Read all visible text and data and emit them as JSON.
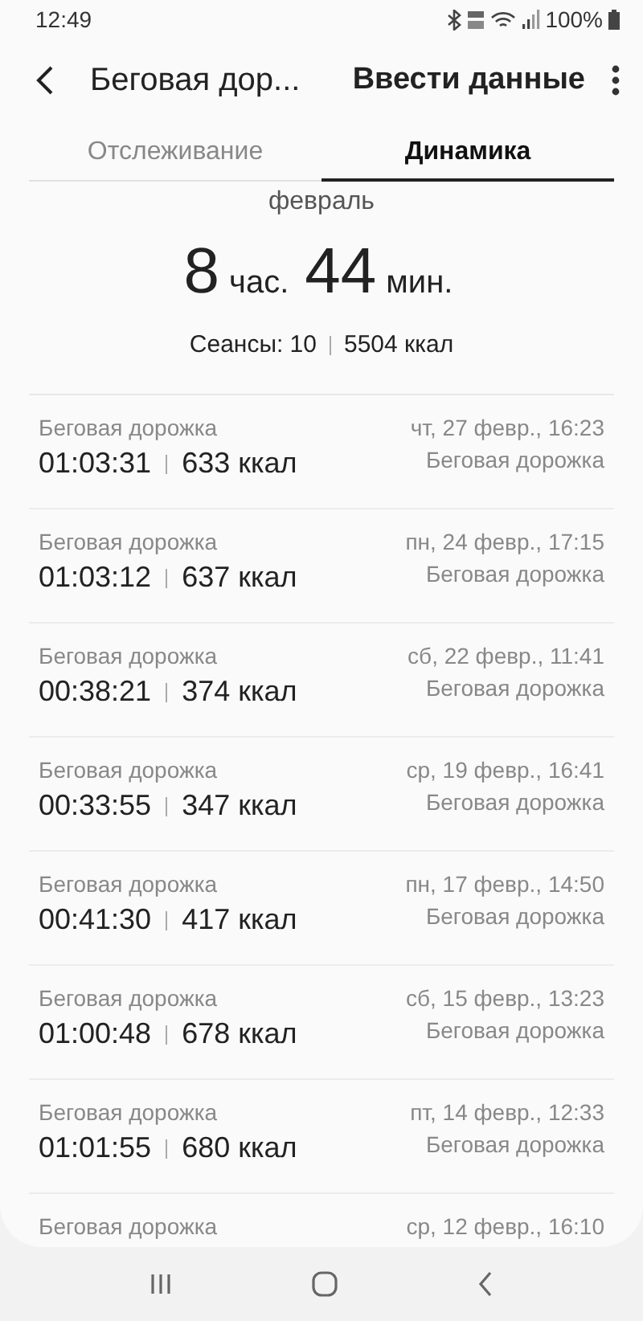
{
  "status_bar": {
    "time": "12:49",
    "battery_text": "100%"
  },
  "header": {
    "title": "Беговая дор...",
    "action": "Ввести данные"
  },
  "tabs": [
    {
      "label": "Отслеживание",
      "selected": false
    },
    {
      "label": "Динамика",
      "selected": true
    }
  ],
  "summary": {
    "month": "февраль",
    "hours": "8",
    "hours_unit": "час.",
    "minutes": "44",
    "minutes_unit": "мин.",
    "sessions": "Сеансы: 10",
    "calories": "5504 ккал"
  },
  "sessions": [
    {
      "title": "Беговая дорожка",
      "duration": "01:03:31",
      "calories": "633 ккал",
      "date": "чт, 27 февр., 16:23",
      "type": "Беговая дорожка"
    },
    {
      "title": "Беговая дорожка",
      "duration": "01:03:12",
      "calories": "637 ккал",
      "date": "пн, 24 февр., 17:15",
      "type": "Беговая дорожка"
    },
    {
      "title": "Беговая дорожка",
      "duration": "00:38:21",
      "calories": "374 ккал",
      "date": "сб, 22 февр., 11:41",
      "type": "Беговая дорожка"
    },
    {
      "title": "Беговая дорожка",
      "duration": "00:33:55",
      "calories": "347 ккал",
      "date": "ср, 19 февр., 16:41",
      "type": "Беговая дорожка"
    },
    {
      "title": "Беговая дорожка",
      "duration": "00:41:30",
      "calories": "417 ккал",
      "date": "пн, 17 февр., 14:50",
      "type": "Беговая дорожка"
    },
    {
      "title": "Беговая дорожка",
      "duration": "01:00:48",
      "calories": "678 ккал",
      "date": "сб, 15 февр., 13:23",
      "type": "Беговая дорожка"
    },
    {
      "title": "Беговая дорожка",
      "duration": "01:01:55",
      "calories": "680 ккал",
      "date": "пт, 14 февр., 12:33",
      "type": "Беговая дорожка"
    },
    {
      "title": "Беговая дорожка",
      "date": "ср, 12 февр., 16:10"
    }
  ]
}
